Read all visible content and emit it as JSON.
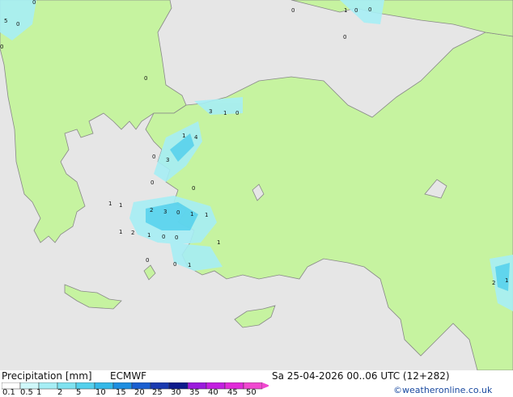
{
  "map": {
    "precip_labels": [
      "0",
      "5",
      "0",
      "0",
      "1",
      "0",
      "0",
      "0",
      "0",
      "0",
      "3",
      "1",
      "0",
      "1",
      "4",
      "3",
      "0",
      "0",
      "0",
      "1",
      "1",
      "2",
      "3",
      "0",
      "1",
      "1",
      "1",
      "2",
      "1",
      "0",
      "0",
      "1",
      "0",
      "0",
      "1",
      "2",
      "1"
    ]
  },
  "legend": {
    "title": "Precipitation [mm]",
    "model": "ECMWF",
    "ticks": [
      "0.1",
      "0.5",
      "1",
      "2",
      "5",
      "10",
      "15",
      "20",
      "25",
      "30",
      "35",
      "40",
      "45",
      "50"
    ],
    "colors": [
      "#ffffff",
      "#cff8fa",
      "#a6eef5",
      "#7fe2f0",
      "#54d0ec",
      "#33b8e8",
      "#1e8ee0",
      "#1a5fd0",
      "#1a3ab0",
      "#0c1a8c",
      "#9a1adc",
      "#c21ee0",
      "#e02ad8",
      "#f048d0"
    ]
  },
  "valid_time": "Sa 25-04-2026 00..06 UTC (12+282)",
  "credit": "©weatheronline.co.uk"
}
